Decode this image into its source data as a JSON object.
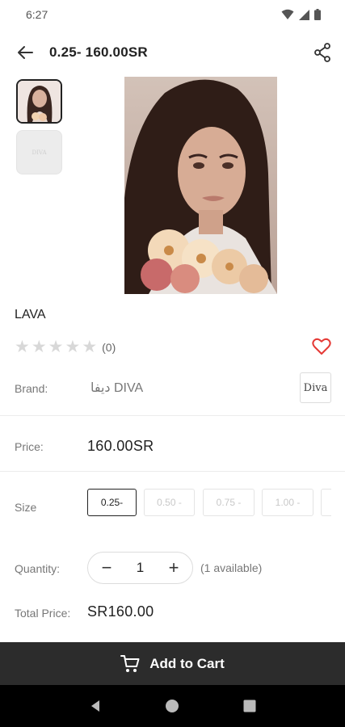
{
  "status_bar": {
    "time": "6:27"
  },
  "header": {
    "title": "0.25- 160.00SR"
  },
  "thumbnails": {
    "second_text": "DIVA"
  },
  "product": {
    "name": "LAVA",
    "rating_count": "(0)",
    "stars": 5,
    "rating": 0
  },
  "brand": {
    "label": "Brand:",
    "value": "ديفا DIVA",
    "logo_text": "Diva"
  },
  "price": {
    "label": "Price:",
    "value": "160.00SR"
  },
  "size": {
    "label": "Size",
    "options": [
      "0.25-",
      "0.50 -",
      "0.75 -",
      "1.00 -",
      ""
    ],
    "selected_index": 0
  },
  "quantity": {
    "label": "Quantity:",
    "minus": "−",
    "value": "1",
    "plus": "+",
    "available": "(1 available)"
  },
  "total": {
    "label": "Total Price:",
    "value": "SR160.00"
  },
  "cart": {
    "label": "Add to Cart"
  },
  "colors": {
    "accent_heart": "#e53935",
    "cart_bar": "#2c2c2c"
  }
}
